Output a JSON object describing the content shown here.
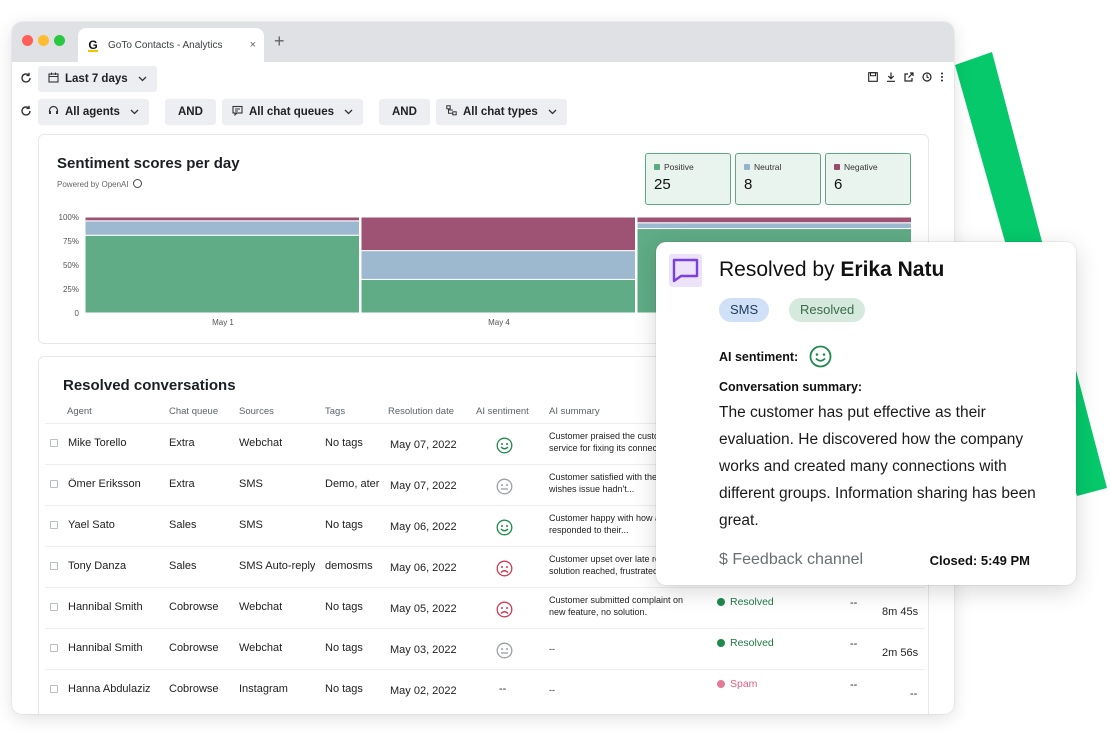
{
  "browser": {
    "tab_title": "GoTo Contacts - Analytics",
    "tab_close": "×",
    "new_tab": "+",
    "favicon_letter": "G"
  },
  "filters": {
    "date_range": "Last 7 days",
    "agents": "All agents",
    "and_1": "AND",
    "queues": "All chat queues",
    "and_2": "AND",
    "chat_types": "All chat types"
  },
  "chart": {
    "title": "Sentiment scores per day",
    "powered_by": "Powered by OpenAI",
    "stats": [
      {
        "label": "Positive",
        "value": "25",
        "color": "#5aab84"
      },
      {
        "label": "Neutral",
        "value": "8",
        "color": "#93b4cb"
      },
      {
        "label": "Negative",
        "value": "6",
        "color": "#9c4a6c"
      }
    ]
  },
  "chart_data": {
    "type": "bar",
    "stacked": true,
    "normalized": true,
    "title": "Sentiment scores per day",
    "ylim": [
      0,
      100
    ],
    "y_ticks": [
      "100%",
      "75%",
      "50%",
      "25%",
      "0"
    ],
    "x_tick_labels": [
      "May 1",
      "May 4"
    ],
    "series": [
      {
        "name": "Positive",
        "color": "#5fac86",
        "values": [
          81,
          35,
          88
        ]
      },
      {
        "name": "Neutral",
        "color": "#9cb9cf",
        "values": [
          15,
          30,
          6
        ]
      },
      {
        "name": "Negative",
        "color": "#9e5274",
        "values": [
          4,
          35,
          6
        ]
      }
    ]
  },
  "table": {
    "title": "Resolved conversations",
    "headers": [
      "Agent",
      "Chat queue",
      "Sources",
      "Tags",
      "Resolution date",
      "AI sentiment",
      "AI summary"
    ],
    "rows": [
      {
        "agent": "Mike Torello",
        "queue": "Extra",
        "source": "Webchat",
        "tags": "No tags",
        "date": "May 07, 2022",
        "sentiment": "positive",
        "summary": "Customer praised the customer service for fixing its connection so...",
        "status": "",
        "c8": "",
        "c9": ""
      },
      {
        "agent": "Ömer Eriksson",
        "queue": "Extra",
        "source": "SMS",
        "tags": "Demo, ater",
        "date": "May 07, 2022",
        "sentiment": "neutral",
        "summary": "Customer satisfied with the help but wishes issue hadn't...",
        "status": "",
        "c8": "",
        "c9": ""
      },
      {
        "agent": "Yael Sato",
        "queue": "Sales",
        "source": "SMS",
        "tags": "No tags",
        "date": "May 06, 2022",
        "sentiment": "positive",
        "summary": "Customer happy with how agent responded to their...",
        "status": "",
        "c8": "",
        "c9": ""
      },
      {
        "agent": "Tony Danza",
        "queue": "Sales",
        "source": "SMS Auto-reply",
        "tags": "demosms",
        "date": "May 06, 2022",
        "sentiment": "negative",
        "summary": "Customer upset over late reply, no solution reached, frustrated...",
        "status": "",
        "c8": "",
        "c9": ""
      },
      {
        "agent": "Hannibal Smith",
        "queue": "Cobrowse",
        "source": "Webchat",
        "tags": "No tags",
        "date": "May 05, 2022",
        "sentiment": "negative",
        "summary": "Customer submitted complaint on new feature, no solution.",
        "status": "Resolved",
        "c8": "--",
        "c9": "8m 45s"
      },
      {
        "agent": "Hannibal Smith",
        "queue": "Cobrowse",
        "source": "Webchat",
        "tags": "No tags",
        "date": "May 03, 2022",
        "sentiment": "neutral",
        "summary": "--",
        "status": "Resolved",
        "c8": "--",
        "c9": "2m 56s"
      },
      {
        "agent": "Hanna Abdulaziz",
        "queue": "Cobrowse",
        "source": "Instagram",
        "tags": "No tags",
        "date": "May 02, 2022",
        "sentiment": "none",
        "sentiment_text": "--",
        "summary": "--",
        "status": "Spam",
        "c8": "--",
        "c9": "--"
      }
    ]
  },
  "detail": {
    "title_prefix": "Resolved by ",
    "agent_name": "Erika Natu",
    "chip_sms": "SMS",
    "chip_resolved": "Resolved",
    "ai_sentiment_label": "AI sentiment:",
    "summary_label": "Conversation summary:",
    "summary_text": "The customer has put effective as their evaluation. He discovered how the company works and created many connections with different groups. Information sharing has been great.",
    "feedback": "$ Feedback channel",
    "closed": "Closed: 5:49 PM"
  }
}
